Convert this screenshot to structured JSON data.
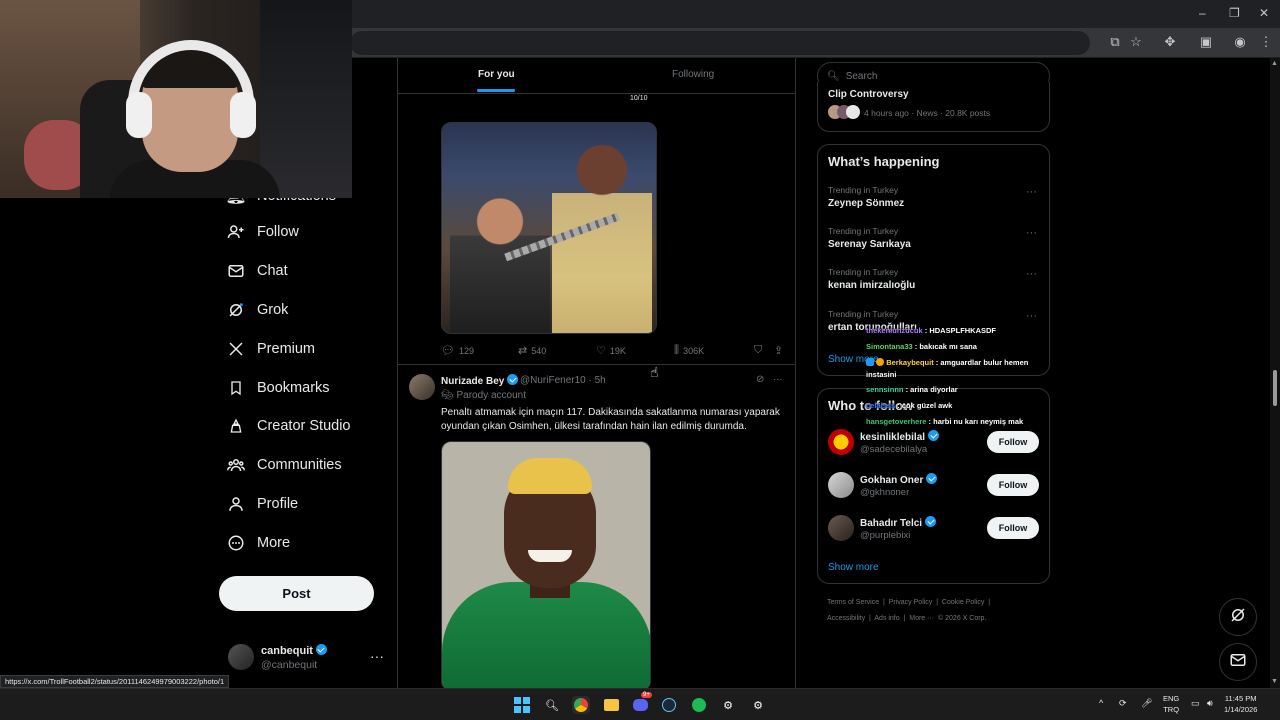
{
  "browser": {
    "window_controls": [
      "–",
      "❐",
      "✕"
    ]
  },
  "nav": {
    "items": [
      {
        "label": "Notifications",
        "icon": "bell-icon"
      },
      {
        "label": "Follow",
        "icon": "person-plus-icon"
      },
      {
        "label": "Chat",
        "icon": "envelope-icon"
      },
      {
        "label": "Grok",
        "icon": "grok-icon"
      },
      {
        "label": "Premium",
        "icon": "x-logo-icon"
      },
      {
        "label": "Bookmarks",
        "icon": "bookmark-icon"
      },
      {
        "label": "Creator Studio",
        "icon": "creator-studio-icon"
      },
      {
        "label": "Communities",
        "icon": "communities-icon"
      },
      {
        "label": "Profile",
        "icon": "person-icon"
      },
      {
        "label": "More",
        "icon": "more-circle-icon"
      }
    ],
    "post_label": "Post",
    "account": {
      "name": "canbequit",
      "handle": "@canbequit"
    }
  },
  "feed": {
    "tabs": [
      {
        "label": "For you"
      },
      {
        "label": "Following"
      }
    ],
    "tweet1": {
      "image_counter": "10/10",
      "replies": "129",
      "reposts": "540",
      "likes": "19K",
      "views": "306K"
    },
    "tweet2": {
      "name": "Nurizade Bey",
      "handle": "@NuriFener10",
      "time": "5h",
      "parody": "Parody account",
      "text": "Penaltı atmamak için maçın 117. Dakikasında sakatlanma numarası yaparak oyundan çıkan Osimhen, ülkesi tarafından hain ilan edilmiş durumda."
    }
  },
  "right": {
    "search_placeholder": "Search",
    "top_trend": {
      "title": "Clip Controversy",
      "meta": "4 hours ago · News · 20.8K posts"
    },
    "whats_happening": {
      "title": "What’s happening",
      "trends": [
        {
          "context": "Trending in Turkey",
          "name": "Zeynep Sönmez"
        },
        {
          "context": "Trending in Turkey",
          "name": "Serenay Sarıkaya"
        },
        {
          "context": "Trending in Turkey",
          "name": "kenan imirzalıoğlu"
        },
        {
          "context": "Trending in Turkey",
          "name": "ertan torunoğulları"
        }
      ],
      "show_more": "Show more"
    },
    "who_to_follow": {
      "title": "Who to follow",
      "users": [
        {
          "name": "kesinliklebilal",
          "handle": "@sadecebilalya",
          "button": "Follow"
        },
        {
          "name": "Gokhan Oner",
          "handle": "@gkhnoner",
          "button": "Follow"
        },
        {
          "name": "Bahadır Telci",
          "handle": "@purplebixi",
          "button": "Follow"
        }
      ],
      "show_more": "Show more"
    },
    "footer": {
      "line1": [
        "Terms of Service",
        "Privacy Policy",
        "Cookie Policy"
      ],
      "line2": [
        "Accessibility",
        "Ads info",
        "More ···",
        "© 2026 X Corp."
      ]
    }
  },
  "chat_overlay": [
    {
      "user": "thekeniunzucuk",
      "msg": " : HDASPLFHKASDF",
      "color": "#b07cff"
    },
    {
      "user": "Simontana33",
      "msg": " : bakıcak mı sana",
      "color": "#5dd35d"
    },
    {
      "user": "Berkaybequit",
      "msg": " : amguardlar bulur hemen instasini",
      "color": "#ffd23f"
    },
    {
      "user": "sennsinnn",
      "msg": " : arina diyorlar",
      "color": "#3ad1a2"
    },
    {
      "user": "celalsss",
      "msg": " : çok güzel awk",
      "color": "#2e7bff"
    },
    {
      "user": "hansgetoverhere",
      "msg": " : harbi nu karı neymiş mak",
      "color": "#37c871"
    }
  ],
  "status_url": "https://x.com/TrollFootball2/status/2011146249979003222/photo/1",
  "taskbar": {
    "lang_top": "ENG",
    "lang_bottom": "TRQ",
    "time": "11:45 PM",
    "date": "1/14/2026",
    "discord_badge": "9+"
  },
  "colors": {
    "accent": "#1d9bf0",
    "background": "#000000",
    "border": "#2f3336"
  }
}
